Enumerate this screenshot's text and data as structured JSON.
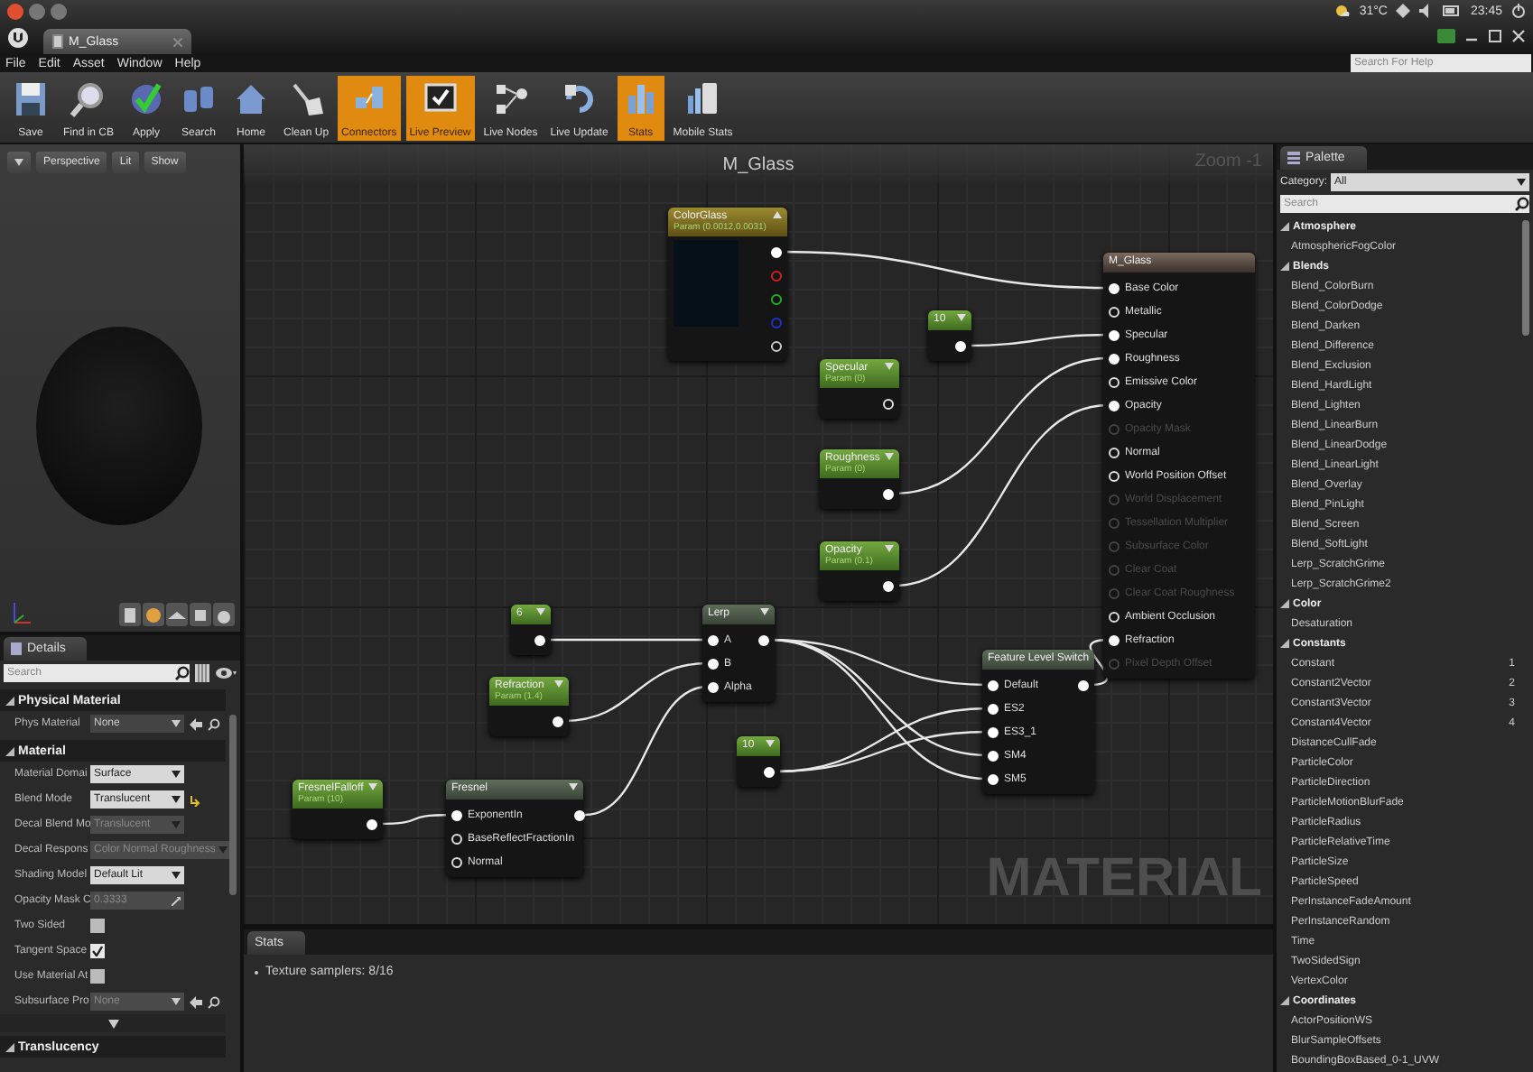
{
  "window": {
    "tab_title": "M_Glass",
    "temperature": "31°C",
    "time": "23:45",
    "help_search": {
      "placeholder": "Search For Help"
    }
  },
  "menu": [
    "File",
    "Edit",
    "Asset",
    "Window",
    "Help"
  ],
  "toolbar": [
    {
      "label": "Save",
      "selected": false
    },
    {
      "label": "Find in CB",
      "selected": false
    },
    {
      "label": "Apply",
      "selected": false
    },
    {
      "label": "Search",
      "selected": false
    },
    {
      "label": "Home",
      "selected": false
    },
    {
      "label": "Clean Up",
      "selected": false
    },
    {
      "label": "Connectors",
      "selected": true
    },
    {
      "label": "Live Preview",
      "selected": true
    },
    {
      "label": "Live Nodes",
      "selected": false
    },
    {
      "label": "Live Update",
      "selected": false
    },
    {
      "label": "Stats",
      "selected": true
    },
    {
      "label": "Mobile Stats",
      "selected": false
    }
  ],
  "viewport": {
    "buttons": [
      "Perspective",
      "Lit",
      "Show"
    ]
  },
  "details": {
    "tab": "Details",
    "search": {
      "placeholder": "Search"
    },
    "sections": [
      {
        "title": "Physical Material",
        "expanded": true,
        "rows": [
          {
            "label": "Phys Material",
            "kind": "asset",
            "value": "None",
            "disabled": false,
            "modified": false
          }
        ]
      },
      {
        "title": "Material",
        "expanded": true,
        "rows": [
          {
            "label": "Material Domai",
            "kind": "dropdown",
            "value": "Surface",
            "disabled": false,
            "modified": false
          },
          {
            "label": "Blend Mode",
            "kind": "dropdown",
            "value": "Translucent",
            "disabled": false,
            "modified": true
          },
          {
            "label": "Decal Blend Mo",
            "kind": "dropdown",
            "value": "Translucent",
            "disabled": true,
            "modified": false
          },
          {
            "label": "Decal Respons",
            "kind": "dropdown",
            "value": "Color Normal Roughness",
            "disabled": true,
            "modified": false
          },
          {
            "label": "Shading Model",
            "kind": "dropdown",
            "value": "Default Lit",
            "disabled": false,
            "modified": false
          },
          {
            "label": "Opacity Mask C",
            "kind": "number",
            "value": "0.3333",
            "disabled": true,
            "modified": false
          },
          {
            "label": "Two Sided",
            "kind": "checkbox",
            "checked": false,
            "disabled": false,
            "modified": false
          },
          {
            "label": "Tangent Space",
            "kind": "checkbox",
            "checked": true,
            "disabled": false,
            "modified": false
          },
          {
            "label": "Use Material At",
            "kind": "checkbox",
            "checked": false,
            "disabled": false,
            "modified": false
          },
          {
            "label": "Subsurface Pro",
            "kind": "asset",
            "value": "None",
            "disabled": true,
            "modified": false
          }
        ]
      },
      {
        "title": "Translucency",
        "expanded": true
      }
    ]
  },
  "graph": {
    "title": "M_Glass",
    "zoom": "Zoom -1",
    "watermark": "MATERIAL",
    "nodes": [
      {
        "kind": "vector_parameter",
        "title": "ColorGlass",
        "subtitle": "Param (0.0012,0.0031)",
        "outputs": [
          {
            "connected": true,
            "color": "#ffffff"
          },
          {
            "connected": false,
            "color": "#d02020"
          },
          {
            "connected": false,
            "color": "#20b020"
          },
          {
            "connected": false,
            "color": "#2030d0"
          },
          {
            "connected": false,
            "color": "#c8c8c8"
          }
        ]
      },
      {
        "kind": "constant",
        "title": "10",
        "outputs": [
          {
            "connected": true
          }
        ]
      },
      {
        "kind": "parameter",
        "title": "Specular",
        "subtitle": "Param (0)",
        "outputs": [
          {
            "connected": false
          }
        ]
      },
      {
        "kind": "parameter",
        "title": "Roughness",
        "subtitle": "Param (0)",
        "outputs": [
          {
            "connected": true
          }
        ]
      },
      {
        "kind": "parameter",
        "title": "Opacity",
        "subtitle": "Param (0.1)",
        "outputs": [
          {
            "connected": true
          }
        ]
      },
      {
        "kind": "result",
        "title": "M_Glass",
        "inputs": [
          {
            "label": "Base Color",
            "connected": true,
            "disabled": false
          },
          {
            "label": "Metallic",
            "connected": false,
            "disabled": false
          },
          {
            "label": "Specular",
            "connected": true,
            "disabled": false
          },
          {
            "label": "Roughness",
            "connected": true,
            "disabled": false
          },
          {
            "label": "Emissive Color",
            "connected": false,
            "disabled": false
          },
          {
            "label": "Opacity",
            "connected": true,
            "disabled": false
          },
          {
            "label": "Opacity Mask",
            "connected": false,
            "disabled": true
          },
          {
            "label": "Normal",
            "connected": false,
            "disabled": false
          },
          {
            "label": "World Position Offset",
            "connected": false,
            "disabled": false
          },
          {
            "label": "World Displacement",
            "connected": false,
            "disabled": true
          },
          {
            "label": "Tessellation Multiplier",
            "connected": false,
            "disabled": true
          },
          {
            "label": "Subsurface Color",
            "connected": false,
            "disabled": true
          },
          {
            "label": "Clear Coat",
            "connected": false,
            "disabled": true
          },
          {
            "label": "Clear Coat Roughness",
            "connected": false,
            "disabled": true
          },
          {
            "label": "Ambient Occlusion",
            "connected": false,
            "disabled": false
          },
          {
            "label": "Refraction",
            "connected": true,
            "disabled": false
          },
          {
            "label": "Pixel Depth Offset",
            "connected": false,
            "disabled": true
          }
        ]
      },
      {
        "kind": "constant",
        "title": "6",
        "outputs": [
          {
            "connected": true
          }
        ]
      },
      {
        "kind": "expression",
        "title": "Lerp",
        "inputs": [
          {
            "label": "A",
            "connected": true,
            "disabled": false
          },
          {
            "label": "B",
            "connected": true,
            "disabled": false
          },
          {
            "label": "Alpha",
            "connected": true,
            "disabled": false
          }
        ],
        "outputs": [
          {
            "connected": true
          }
        ]
      },
      {
        "kind": "parameter",
        "title": "Refraction",
        "subtitle": "Param (1.4)",
        "outputs": [
          {
            "connected": true
          }
        ]
      },
      {
        "kind": "constant",
        "title": "10",
        "outputs": [
          {
            "connected": true
          }
        ]
      },
      {
        "kind": "expression",
        "title": "Feature Level Switch",
        "inputs": [
          {
            "label": "Default",
            "connected": true,
            "disabled": false
          },
          {
            "label": "ES2",
            "connected": true,
            "disabled": false
          },
          {
            "label": "ES3_1",
            "connected": true,
            "disabled": false
          },
          {
            "label": "SM4",
            "connected": true,
            "disabled": false
          },
          {
            "label": "SM5",
            "connected": true,
            "disabled": false
          }
        ],
        "outputs": [
          {
            "connected": true
          }
        ]
      },
      {
        "kind": "parameter",
        "title": "FresnelFalloff",
        "subtitle": "Param (10)",
        "outputs": [
          {
            "connected": true
          }
        ]
      },
      {
        "kind": "expression",
        "title": "Fresnel",
        "inputs": [
          {
            "label": "ExponentIn",
            "connected": true,
            "disabled": false
          },
          {
            "label": "BaseReflectFractionIn",
            "connected": false,
            "disabled": false
          },
          {
            "label": "Normal",
            "connected": false,
            "disabled": false
          }
        ],
        "outputs": [
          {
            "connected": true
          }
        ]
      }
    ]
  },
  "stats": {
    "tab": "Stats",
    "lines": [
      "Texture samplers: 8/16"
    ]
  },
  "palette": {
    "tab": "Palette",
    "category_label": "Category:",
    "category": "All",
    "search": {
      "placeholder": "Search"
    },
    "groups": [
      {
        "title": "Atmosphere",
        "expanded": true,
        "items": [
          {
            "label": "AtmosphericFogColor"
          }
        ]
      },
      {
        "title": "Blends",
        "expanded": true,
        "items": [
          {
            "label": "Blend_ColorBurn"
          },
          {
            "label": "Blend_ColorDodge"
          },
          {
            "label": "Blend_Darken"
          },
          {
            "label": "Blend_Difference"
          },
          {
            "label": "Blend_Exclusion"
          },
          {
            "label": "Blend_HardLight"
          },
          {
            "label": "Blend_Lighten"
          },
          {
            "label": "Blend_LinearBurn"
          },
          {
            "label": "Blend_LinearDodge"
          },
          {
            "label": "Blend_LinearLight"
          },
          {
            "label": "Blend_Overlay"
          },
          {
            "label": "Blend_PinLight"
          },
          {
            "label": "Blend_Screen"
          },
          {
            "label": "Blend_SoftLight"
          },
          {
            "label": "Lerp_ScratchGrime"
          },
          {
            "label": "Lerp_ScratchGrime2"
          }
        ]
      },
      {
        "title": "Color",
        "expanded": true,
        "items": [
          {
            "label": "Desaturation"
          }
        ]
      },
      {
        "title": "Constants",
        "expanded": true,
        "items": [
          {
            "label": "Constant",
            "hotkey": "1"
          },
          {
            "label": "Constant2Vector",
            "hotkey": "2"
          },
          {
            "label": "Constant3Vector",
            "hotkey": "3"
          },
          {
            "label": "Constant4Vector",
            "hotkey": "4"
          },
          {
            "label": "DistanceCullFade"
          },
          {
            "label": "ParticleColor"
          },
          {
            "label": "ParticleDirection"
          },
          {
            "label": "ParticleMotionBlurFade"
          },
          {
            "label": "ParticleRadius"
          },
          {
            "label": "ParticleRelativeTime"
          },
          {
            "label": "ParticleSize"
          },
          {
            "label": "ParticleSpeed"
          },
          {
            "label": "PerInstanceFadeAmount"
          },
          {
            "label": "PerInstanceRandom"
          },
          {
            "label": "Time"
          },
          {
            "label": "TwoSidedSign"
          },
          {
            "label": "VertexColor"
          }
        ]
      },
      {
        "title": "Coordinates",
        "expanded": true,
        "items": [
          {
            "label": "ActorPositionWS"
          },
          {
            "label": "BlurSampleOffsets"
          },
          {
            "label": "BoundingBoxBased_0-1_UVW"
          }
        ]
      }
    ]
  }
}
